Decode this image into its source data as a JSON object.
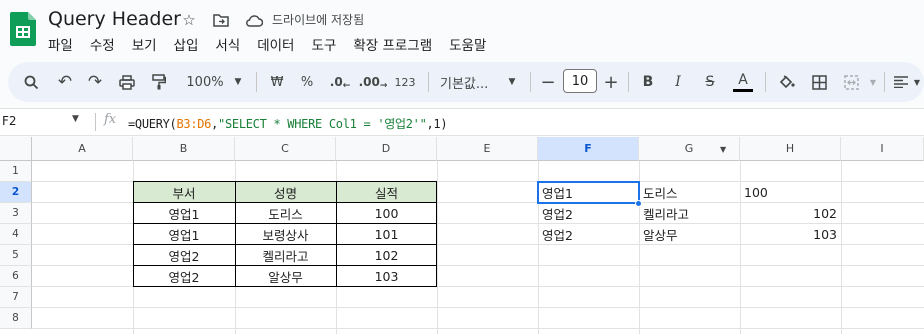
{
  "app": {
    "title": "Query Header",
    "saved_status": "드라이브에 저장됨",
    "menu": [
      "파일",
      "수정",
      "보기",
      "삽입",
      "서식",
      "데이터",
      "도구",
      "확장 프로그램",
      "도움말"
    ]
  },
  "toolbar": {
    "zoom": "100%",
    "currency": "₩",
    "percent": "%",
    "dec_decrease": ".0",
    "dec_increase": ".00",
    "number_format": "123",
    "font": "기본값...",
    "font_size": "10",
    "bold": "B",
    "italic": "I",
    "strike": "S",
    "text_color": "A"
  },
  "formula_bar": {
    "name_box": "F2",
    "fx": "fx",
    "formula_prefix": "=QUERY(",
    "formula_ref": "B3:D6",
    "formula_mid": ",",
    "formula_str": "\"SELECT * WHERE Col1 = '영업2'\"",
    "formula_suffix": ",1)"
  },
  "columns": [
    "A",
    "B",
    "C",
    "D",
    "E",
    "F",
    "G",
    "H",
    "I"
  ],
  "rows": [
    "1",
    "2",
    "3",
    "4",
    "5",
    "6",
    "7",
    "8"
  ],
  "source_table": {
    "headers": [
      "부서",
      "성명",
      "실적"
    ],
    "rows": [
      [
        "영업1",
        "도리스",
        "100"
      ],
      [
        "영업1",
        "보령상사",
        "101"
      ],
      [
        "영업2",
        "켈리라고",
        "102"
      ],
      [
        "영업2",
        "알상무",
        "103"
      ]
    ]
  },
  "query_result": {
    "rows": [
      [
        "영업1",
        "도리스",
        "100"
      ],
      [
        "영업2",
        "켈리라고",
        "102"
      ],
      [
        "영업2",
        "알상무",
        "103"
      ]
    ]
  },
  "colors": {
    "header_fill": "#d9ead3",
    "selection": "#1a73e8",
    "logo_green": "#0f9d58"
  }
}
